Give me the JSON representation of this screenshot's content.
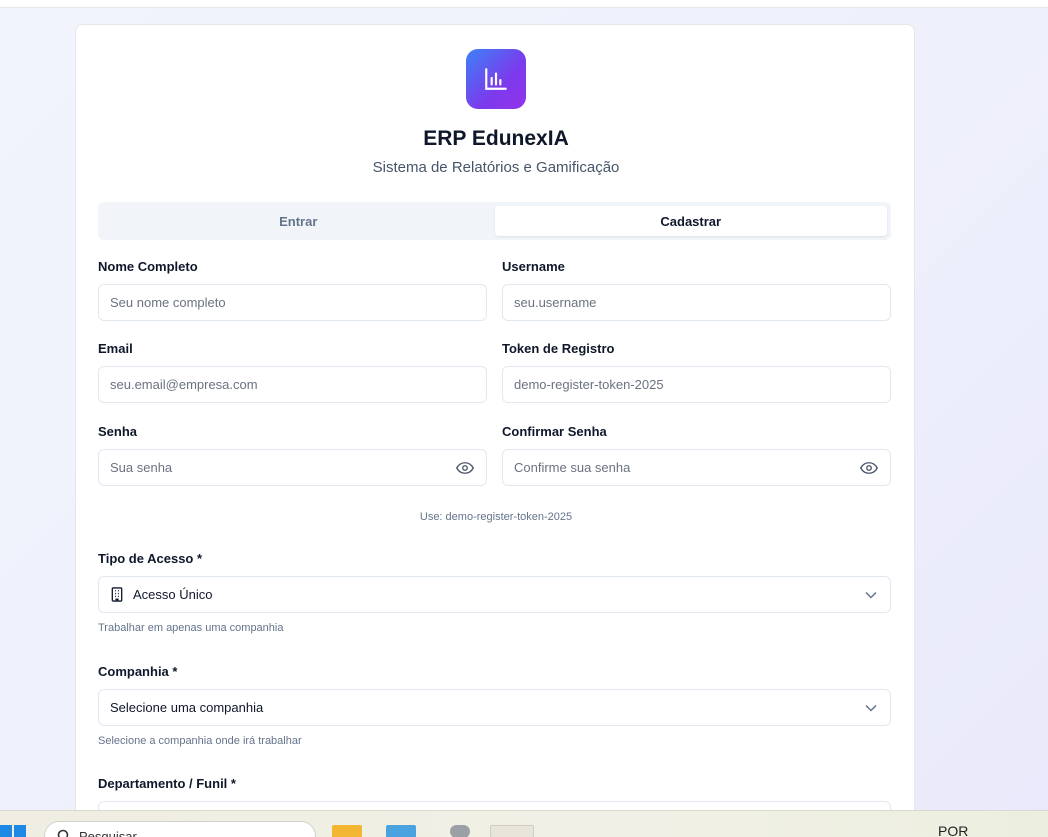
{
  "app": {
    "title": "ERP EdunexIA",
    "subtitle": "Sistema de Relatórios e Gamificação",
    "brand_gradient": [
      "#3b82f6",
      "#9333ea"
    ],
    "logo_icon": "bar-chart-icon"
  },
  "tabs": [
    {
      "label": "Entrar",
      "active": false
    },
    {
      "label": "Cadastrar",
      "active": true
    }
  ],
  "form": {
    "nome": {
      "label": "Nome Completo",
      "placeholder": "Seu nome completo"
    },
    "username": {
      "label": "Username",
      "placeholder": "seu.username"
    },
    "email": {
      "label": "Email",
      "placeholder": "seu.email@empresa.com"
    },
    "token": {
      "label": "Token de Registro",
      "placeholder": "demo-register-token-2025"
    },
    "senha": {
      "label": "Senha",
      "placeholder": "Sua senha",
      "icon": "eye-icon"
    },
    "confirmar": {
      "label": "Confirmar Senha",
      "placeholder": "Confirme sua senha",
      "icon": "eye-icon"
    },
    "token_hint": "Use: demo-register-token-2025",
    "tipo_acesso": {
      "label": "Tipo de Acesso *",
      "value": "Acesso Único",
      "icon": "building-icon",
      "help": "Trabalhar em apenas uma companhia"
    },
    "companhia": {
      "label": "Companhia *",
      "value": "Selecione uma companhia",
      "help": "Selecione a companhia onde irá trabalhar"
    },
    "departamento": {
      "label": "Departamento / Funil *"
    }
  },
  "taskbar": {
    "search_text": "Pesquisar",
    "language": "POR"
  }
}
